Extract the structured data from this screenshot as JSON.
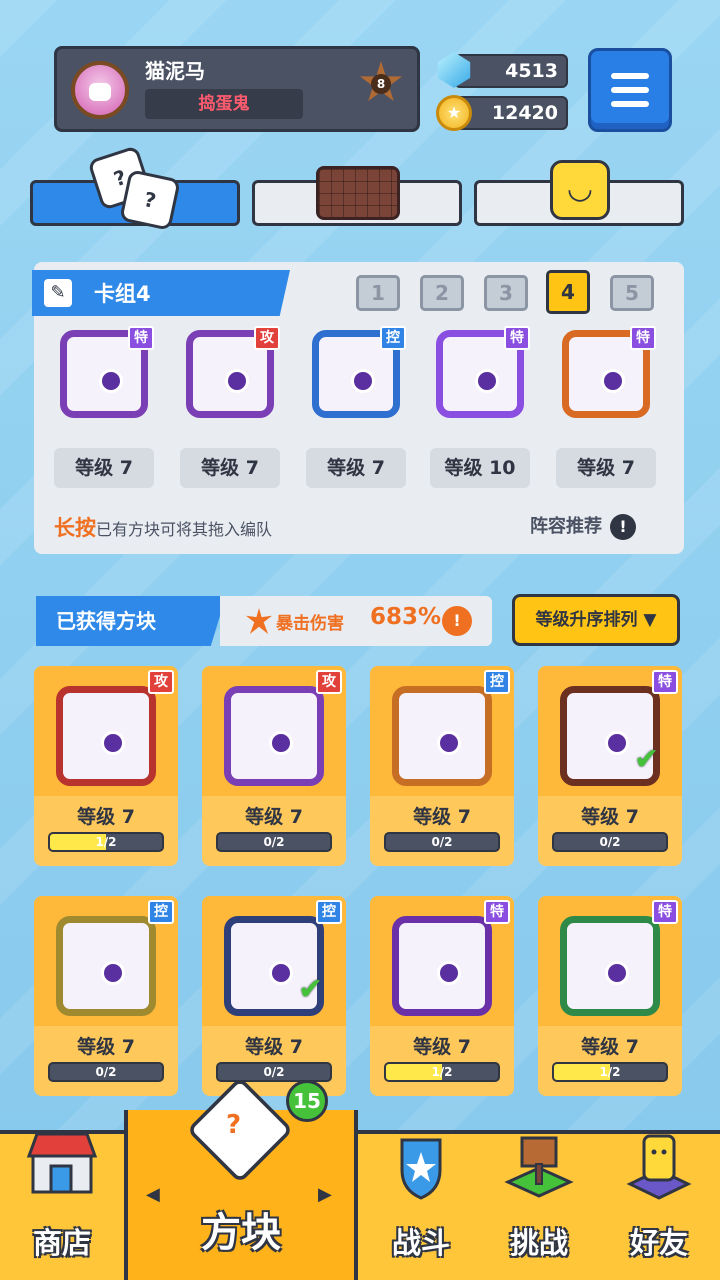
{
  "header": {
    "player_name": "猫泥马",
    "player_title": "捣蛋鬼",
    "rank": "8",
    "gems": "4513",
    "coins": "12420"
  },
  "deck": {
    "title": "卡组4",
    "slots": [
      "1",
      "2",
      "3",
      "4",
      "5"
    ],
    "active_slot": "4",
    "cards": [
      {
        "tag": "特",
        "level": "等级 7",
        "color": "#7a3fb4"
      },
      {
        "tag": "攻",
        "level": "等级 7",
        "color": "#7a3fb4"
      },
      {
        "tag": "控",
        "level": "等级 7",
        "color": "#2f6fd0"
      },
      {
        "tag": "特",
        "level": "等级 10",
        "color": "#8a4fe0"
      },
      {
        "tag": "特",
        "level": "等级 7",
        "color": "#d86a24"
      }
    ],
    "hint_strong": "长按",
    "hint_text": "已有方块可将其拖入编队",
    "recommend": "阵容推荐"
  },
  "collection": {
    "title": "已获得方块",
    "crit_label": "暴击伤害",
    "crit_value": "683%",
    "sort_label": "等级升序排列 ▼",
    "cards": [
      {
        "tag": "攻",
        "level": "等级 7",
        "progress": "1/2",
        "fill": 0.5,
        "color": "#b8322e"
      },
      {
        "tag": "攻",
        "level": "等级 7",
        "progress": "0/2",
        "fill": 0,
        "color": "#7a3fb4"
      },
      {
        "tag": "控",
        "level": "等级 7",
        "progress": "0/2",
        "fill": 0,
        "color": "#c66e24"
      },
      {
        "tag": "特",
        "level": "等级 7",
        "progress": "0/2",
        "fill": 0,
        "color": "#6b3020"
      },
      {
        "tag": "控",
        "level": "等级 7",
        "progress": "0/2",
        "fill": 0,
        "color": "#a08a30"
      },
      {
        "tag": "控",
        "level": "等级 7",
        "progress": "0/2",
        "fill": 0,
        "color": "#2e3f7a"
      },
      {
        "tag": "特",
        "level": "等级 7",
        "progress": "1/2",
        "fill": 0.5,
        "color": "#6a30a8"
      },
      {
        "tag": "特",
        "level": "等级 7",
        "progress": "1/2",
        "fill": 0.5,
        "color": "#2f8a4a"
      }
    ]
  },
  "nav": {
    "shop": "商店",
    "blocks": "方块",
    "battle": "战斗",
    "challenge": "挑战",
    "friends": "好友",
    "blocks_badge": "15"
  },
  "icons": {
    "menu": "menu-icon",
    "gem": "gem-icon",
    "coin": "coin-icon",
    "dice": "dice-icon",
    "board": "board-icon",
    "smile": "smile-icon"
  }
}
